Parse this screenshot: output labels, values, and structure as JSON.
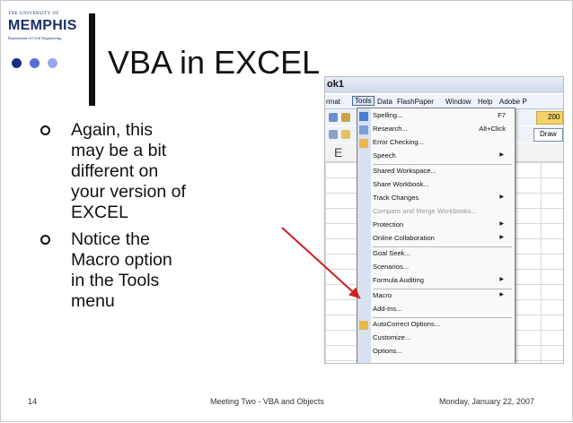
{
  "logo": {
    "university": "The University of",
    "name": "MEMPHIS",
    "department": "Department of Civil Engineering"
  },
  "slide": {
    "title": "VBA in EXCEL"
  },
  "bullets": [
    {
      "text": "Again, this\nmay be a bit\ndifferent on\nyour version of\nEXCEL"
    },
    {
      "text": "Notice the\nMacro option\nin the Tools\nmenu"
    }
  ],
  "footer": {
    "page": "14",
    "center": "Meeting Two - VBA and Objects",
    "date": "Monday, January 22, 2007"
  },
  "screenshot": {
    "window_title": "ok1",
    "menubar": [
      "rmat",
      "Tools",
      "Data",
      "FlashPaper",
      "Window",
      "Help",
      "Adobe P"
    ],
    "active_menu": "Tools",
    "toolbar_button": "200",
    "draw_button": "Draw",
    "cell_header": "E",
    "menu_items": [
      {
        "label": "Spelling...",
        "shortcut": "F7",
        "submenu": false,
        "disabled": false
      },
      {
        "label": "Research...",
        "shortcut": "Alt+Click",
        "submenu": false,
        "disabled": false
      },
      {
        "label": "Error Checking...",
        "shortcut": "",
        "submenu": false,
        "disabled": false
      },
      {
        "label": "Speech",
        "shortcut": "",
        "submenu": true,
        "disabled": false
      },
      {
        "label": "Shared Workspace...",
        "shortcut": "",
        "submenu": false,
        "disabled": false
      },
      {
        "label": "Share Workbook...",
        "shortcut": "",
        "submenu": false,
        "disabled": false
      },
      {
        "label": "Track Changes",
        "shortcut": "",
        "submenu": true,
        "disabled": false
      },
      {
        "label": "Compare and Merge Workbooks...",
        "shortcut": "",
        "submenu": false,
        "disabled": true
      },
      {
        "label": "Protection",
        "shortcut": "",
        "submenu": true,
        "disabled": false
      },
      {
        "label": "Online Collaboration",
        "shortcut": "",
        "submenu": true,
        "disabled": false
      },
      {
        "label": "Goal Seek...",
        "shortcut": "",
        "submenu": false,
        "disabled": false
      },
      {
        "label": "Scenarios...",
        "shortcut": "",
        "submenu": false,
        "disabled": false
      },
      {
        "label": "Formula Auditing",
        "shortcut": "",
        "submenu": true,
        "disabled": false
      },
      {
        "label": "Macro",
        "shortcut": "",
        "submenu": true,
        "disabled": false
      },
      {
        "label": "Add-Ins...",
        "shortcut": "",
        "submenu": false,
        "disabled": false
      },
      {
        "label": "AutoCorrect Options...",
        "shortcut": "",
        "submenu": false,
        "disabled": false
      },
      {
        "label": "Customize...",
        "shortcut": "",
        "submenu": false,
        "disabled": false
      },
      {
        "label": "Options...",
        "shortcut": "",
        "submenu": false,
        "disabled": false
      }
    ]
  },
  "colors": {
    "dot1": "#1b2b8c",
    "dot2": "#5a6fd0",
    "dot3": "#9aa6e8",
    "arrow": "#cc1f1f",
    "menu_gutter": "#d9e1f0"
  }
}
